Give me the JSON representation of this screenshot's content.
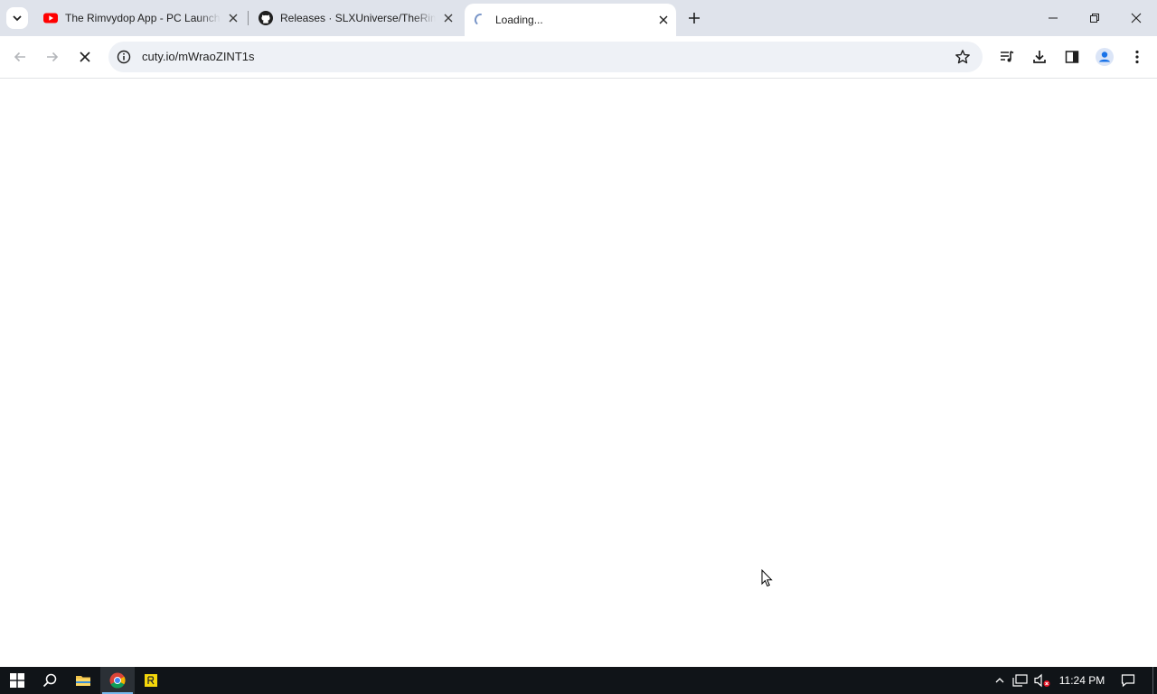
{
  "browser": {
    "tabs": [
      {
        "title": "The Rimvydop App - PC Launcher",
        "favicon": "youtube-icon",
        "active": false
      },
      {
        "title": "Releases · SLXUniverse/TheRimvydopApp",
        "favicon": "github-icon",
        "active": false
      },
      {
        "title": "Loading...",
        "favicon": "loading-spinner-icon",
        "active": true
      }
    ],
    "address_bar": {
      "url": "cuty.io/mWraoZINT1s"
    },
    "page_state": "loading"
  },
  "taskbar": {
    "apps": [
      {
        "name": "file-explorer-icon"
      },
      {
        "name": "chrome-icon",
        "active": true
      },
      {
        "name": "notes-app-icon"
      }
    ],
    "clock": {
      "time": "11:24 PM"
    }
  },
  "colors": {
    "tabstrip_bg": "#dfe3eb",
    "omnibox_bg": "#eef1f6",
    "taskbar_bg": "#101418",
    "profile_blue": "#1a73e8"
  }
}
